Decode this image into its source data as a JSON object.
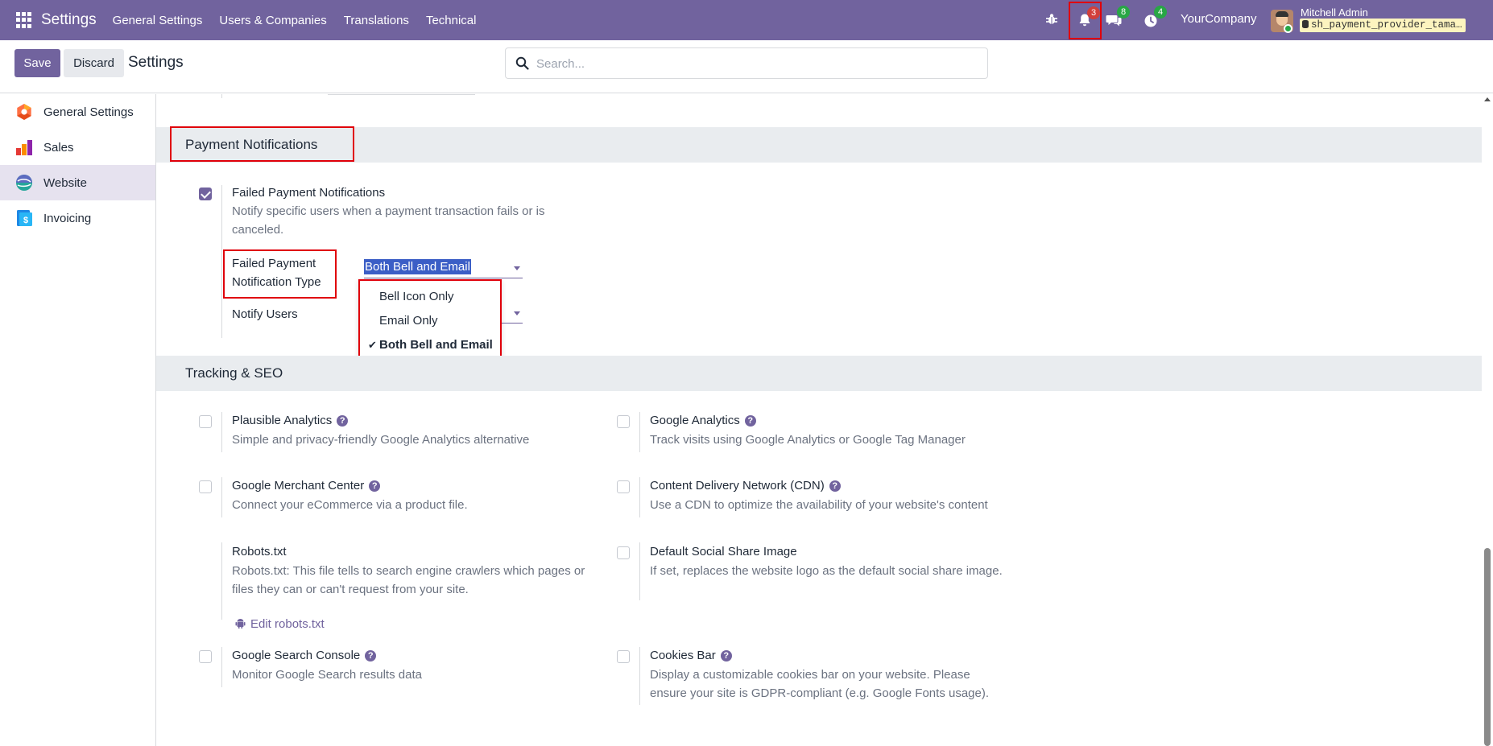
{
  "navbar": {
    "brand": "Settings",
    "menus": [
      "General Settings",
      "Users & Companies",
      "Translations",
      "Technical"
    ],
    "notification_count": "3",
    "message_count": "8",
    "activity_count": "4",
    "company": "YourCompany",
    "user_name": "Mitchell Admin",
    "database": "sh_payment_provider_tama…"
  },
  "control_panel": {
    "save_label": "Save",
    "discard_label": "Discard",
    "title": "Settings",
    "search_placeholder": "Search..."
  },
  "sidebar": {
    "items": [
      {
        "label": "General Settings",
        "icon": "general-settings-icon",
        "color": "#ff6b35"
      },
      {
        "label": "Sales",
        "icon": "sales-icon",
        "color": "#e74c3c"
      },
      {
        "label": "Website",
        "icon": "website-icon",
        "color": "#1abc9c"
      },
      {
        "label": "Invoicing",
        "icon": "invoicing-icon",
        "color": "#1e88e5"
      }
    ],
    "active": "Website"
  },
  "payment_notifications": {
    "section_title": "Payment Notifications",
    "failed_title": "Failed Payment Notifications",
    "failed_desc": "Notify specific users when a payment transaction fails or is canceled.",
    "failed_checked": true,
    "type_label": "Failed Payment Notification Type",
    "type_value": "Both Bell and Email",
    "notify_users_label": "Notify Users",
    "type_options": [
      "Bell Icon Only",
      "Email Only",
      "Both Bell and Email"
    ]
  },
  "tracking_seo": {
    "section_title": "Tracking & SEO",
    "settings": [
      {
        "title": "Plausible Analytics",
        "desc": "Simple and privacy-friendly Google Analytics alternative",
        "help": true
      },
      {
        "title": "Google Analytics",
        "desc": "Track visits using Google Analytics or Google Tag Manager",
        "help": true
      },
      {
        "title": "Google Merchant Center",
        "desc": "Connect your eCommerce via a product file.",
        "help": true
      },
      {
        "title": "Content Delivery Network (CDN)",
        "desc": "Use a CDN to optimize the availability of your website's content",
        "help": true
      },
      {
        "title": "Robots.txt",
        "desc": "Robots.txt: This file tells to search engine crawlers which pages or files they can or can't request from your site.",
        "help": false
      },
      {
        "title": "Default Social Share Image",
        "desc": "If set, replaces the website logo as the default social share image.",
        "help": false
      },
      {
        "title": "Google Search Console",
        "desc": "Monitor Google Search results data",
        "help": true
      },
      {
        "title": "Cookies Bar",
        "desc": "Display a customizable cookies bar on your website. Please ensure your site is GDPR-compliant (e.g. Google Fonts usage).",
        "help": true
      }
    ],
    "robots_link": "Edit robots.txt",
    "help_glyph": "?"
  },
  "colors": {
    "brand": "#71639e",
    "highlight_box": "#e0000a"
  }
}
